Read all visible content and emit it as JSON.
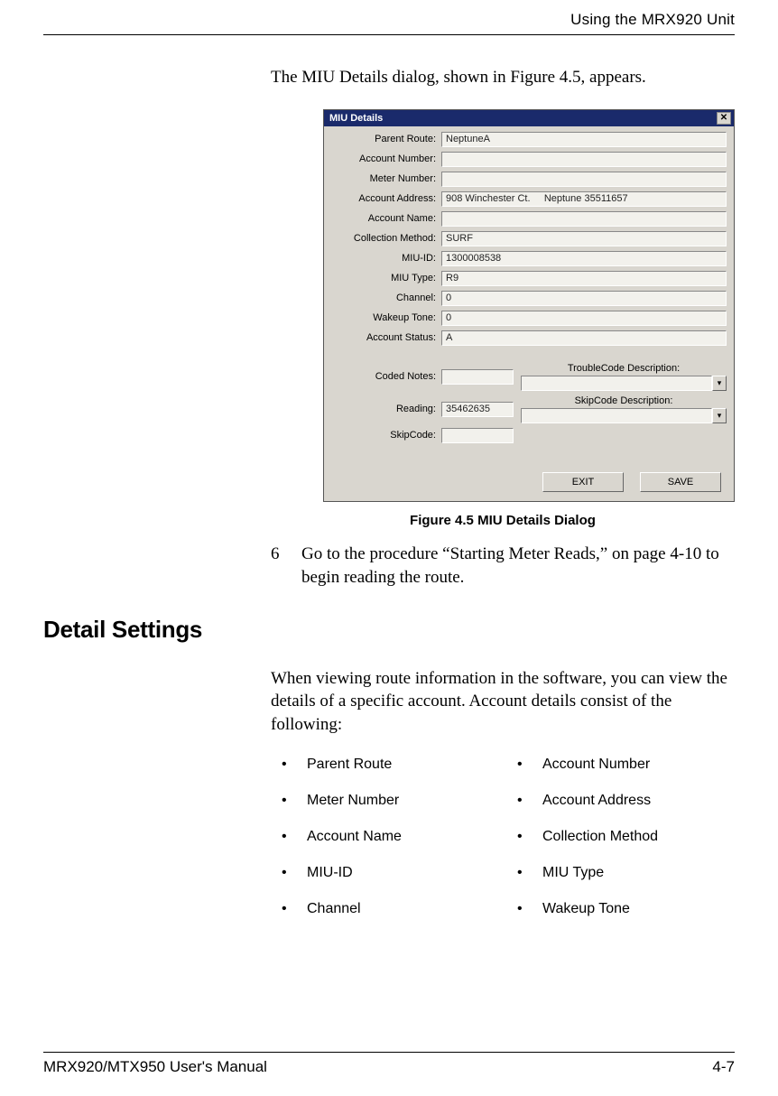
{
  "header": {
    "running_title": "Using the MRX920 Unit"
  },
  "intro_text": "The MIU Details dialog, shown in Figure 4.5, appears.",
  "dialog": {
    "title": "MIU Details",
    "close_glyph": "✕",
    "fields": {
      "parent_route": {
        "label": "Parent Route:",
        "value": "NeptuneA"
      },
      "account_number": {
        "label": "Account Number:",
        "value": ""
      },
      "meter_number": {
        "label": "Meter Number:",
        "value": ""
      },
      "account_address": {
        "label": "Account Address:",
        "value": "908 Winchester Ct.     Neptune 35511657"
      },
      "account_name": {
        "label": "Account Name:",
        "value": ""
      },
      "collection_method": {
        "label": "Collection Method:",
        "value": "SURF"
      },
      "miu_id": {
        "label": "MIU-ID:",
        "value": "1300008538"
      },
      "miu_type": {
        "label": "MIU Type:",
        "value": "R9"
      },
      "channel": {
        "label": "Channel:",
        "value": "0"
      },
      "wakeup_tone": {
        "label": "Wakeup Tone:",
        "value": "0"
      },
      "account_status": {
        "label": "Account Status:",
        "value": "A"
      },
      "coded_notes": {
        "label": "Coded Notes:",
        "value": ""
      },
      "reading": {
        "label": "Reading:",
        "value": "35462635"
      },
      "skip_code": {
        "label": "SkipCode:",
        "value": ""
      },
      "troublecode_desc": {
        "label": "TroubleCode Description:",
        "value": ""
      },
      "skipcode_desc": {
        "label": "SkipCode Description:",
        "value": ""
      }
    },
    "buttons": {
      "exit": "EXIT",
      "save": "SAVE"
    },
    "dropdown_glyph": "▾"
  },
  "figure_caption": "Figure 4.5   MIU Details Dialog",
  "step": {
    "number": "6",
    "text": "Go to the procedure “Starting Meter Reads,” on page 4-10 to begin reading the route."
  },
  "section_heading": "Detail Settings",
  "section_intro": "When viewing route information in the software, you can view the details of a specific account. Account details consist of the following:",
  "bullets": {
    "left": [
      "Parent Route",
      "Meter Number",
      "Account Name",
      "MIU-ID",
      "Channel"
    ],
    "right": [
      "Account Number",
      "Account Address",
      "Collection Method",
      "MIU Type",
      "Wakeup Tone"
    ]
  },
  "bullet_glyph": "•",
  "footer": {
    "manual": "MRX920/MTX950 User's Manual",
    "page": "4-7"
  }
}
